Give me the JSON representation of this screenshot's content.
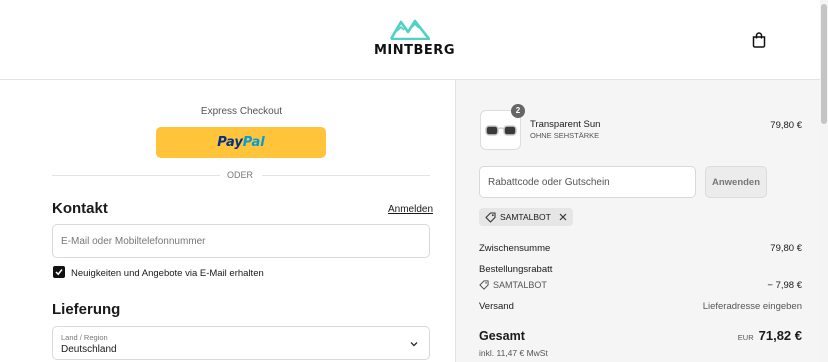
{
  "header": {
    "brand": "MINTBERG",
    "brand_color": "#4fd1c5"
  },
  "left": {
    "express_checkout": "Express Checkout",
    "paypal": {
      "part1": "Pay",
      "part2": "Pal"
    },
    "divider_text": "ODER",
    "contact": {
      "heading": "Kontakt",
      "login_link": "Anmelden",
      "email_placeholder": "E-Mail oder Mobiltelefonnummer",
      "newsletter_label": "Neuigkeiten und Angebote via E-Mail erhalten",
      "newsletter_checked": true
    },
    "delivery": {
      "heading": "Lieferung",
      "country_label": "Land / Region",
      "country_value": "Deutschland"
    }
  },
  "summary": {
    "product": {
      "quantity": "2",
      "name": "Transparent Sun",
      "variant": "OHNE SEHSTÄRKE",
      "price": "79,80 €"
    },
    "discount_placeholder": "Rabattcode oder Gutschein",
    "apply_label": "Anwenden",
    "applied_code": "SAMTALBOT",
    "subtotal_label": "Zwischensumme",
    "subtotal_value": "79,80 €",
    "order_discount_label": "Bestellungsrabatt",
    "discount_code": "SAMTALBOT",
    "discount_value": "− 7,98 €",
    "shipping_label": "Versand",
    "shipping_value": "Lieferadresse eingeben",
    "total_label": "Gesamt",
    "currency": "EUR",
    "total_value": "71,82 €",
    "tax_note": "inkl. 11,47 € MwSt"
  }
}
